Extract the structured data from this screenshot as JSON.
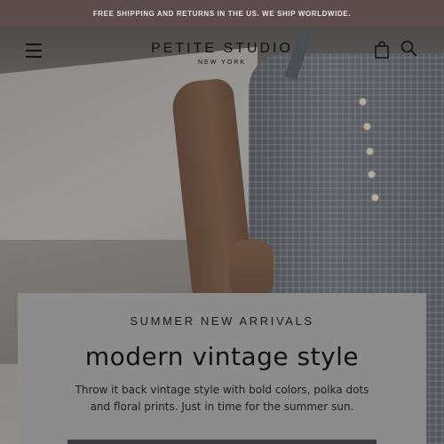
{
  "promo_bar": {
    "text": "FREE SHIPPING AND RETURNS IN THE US. WE SHIP WORLDWIDE."
  },
  "header": {
    "logo_name": "PETITE STUDIO",
    "logo_sub": "NEW YORK",
    "icons": [
      "menu-icon",
      "cart-icon",
      "search-icon"
    ]
  },
  "hero": {
    "eyebrow": "SUMMER NEW ARRIVALS",
    "title": "modern vintage style",
    "description": "Throw it back vintage style with bold colors, polka dots and floral prints.  Just in time for the summer sun."
  },
  "colors": {
    "promo_bg": "#5c4d48",
    "card_bg": "#8c8c8c",
    "button_bg": "#3c3c3e"
  }
}
